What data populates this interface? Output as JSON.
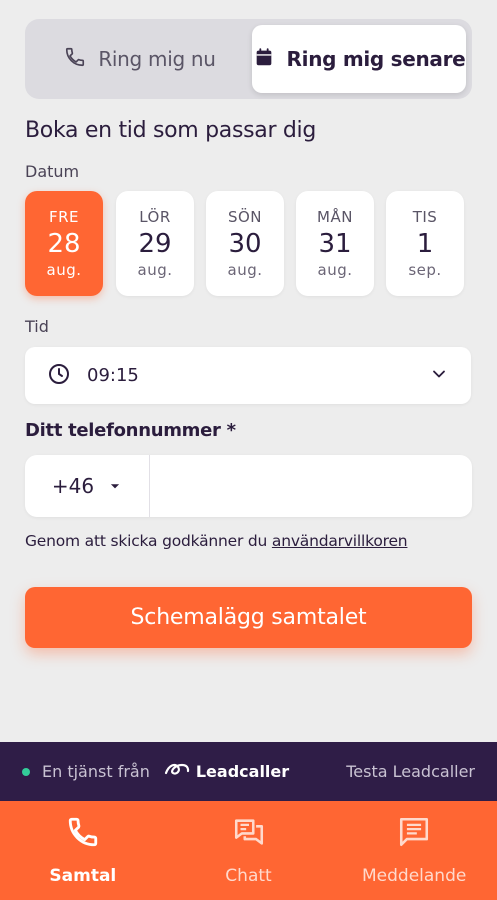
{
  "tabs": {
    "now_label": "Ring mig nu",
    "later_label": "Ring mig senare"
  },
  "heading": "Boka en tid som passar dig",
  "date_label": "Datum",
  "dates": [
    {
      "dow": "FRE",
      "day": "28",
      "month": "aug.",
      "selected": true
    },
    {
      "dow": "LÖR",
      "day": "29",
      "month": "aug.",
      "selected": false
    },
    {
      "dow": "SÖN",
      "day": "30",
      "month": "aug.",
      "selected": false
    },
    {
      "dow": "MÅN",
      "day": "31",
      "month": "aug.",
      "selected": false
    },
    {
      "dow": "TIS",
      "day": "1",
      "month": "sep.",
      "selected": false
    }
  ],
  "time_label": "Tid",
  "time_value": "09:15",
  "phone": {
    "label": "Ditt telefonnummer *",
    "country_code": "+46",
    "value": "",
    "placeholder": ""
  },
  "terms": {
    "text": "Genom att skicka godkänner du ",
    "link": "användarvillkoren"
  },
  "submit_label": "Schemalägg samtalet",
  "footer": {
    "service_text": "En tjänst från",
    "brand": "Leadcaller",
    "cta": "Testa Leadcaller"
  },
  "nav": [
    {
      "label": "Samtal",
      "icon": "phone-icon",
      "active": true
    },
    {
      "label": "Chatt",
      "icon": "chat-icon",
      "active": false
    },
    {
      "label": "Meddelande",
      "icon": "message-icon",
      "active": false
    }
  ],
  "colors": {
    "accent": "#ff6633",
    "footer_bg": "#2f1d47",
    "text": "#2b1d3d",
    "status_dot": "#33cc99"
  }
}
